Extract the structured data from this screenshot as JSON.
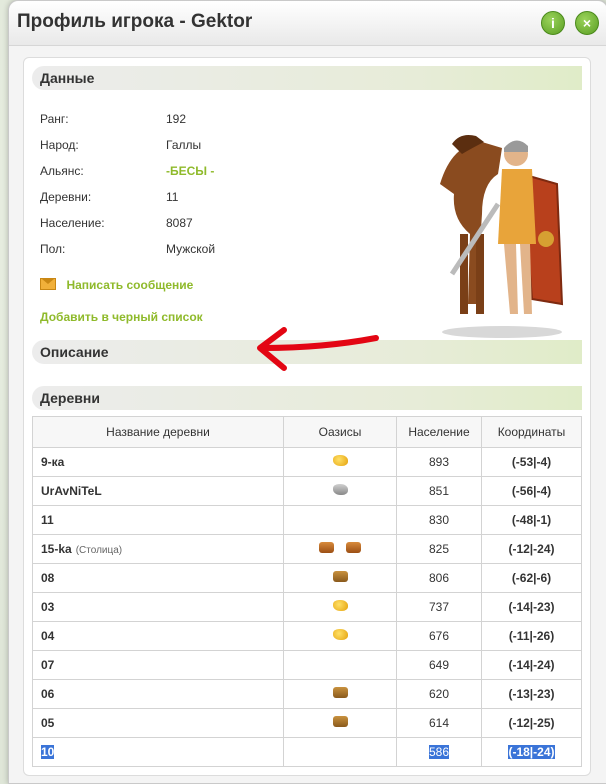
{
  "window": {
    "title": "Профиль игрока - Gektor",
    "info_icon": "info-icon",
    "close_icon": "close-icon"
  },
  "data_section": {
    "heading": "Данные",
    "fields": [
      {
        "label": "Ранг:",
        "value": "192"
      },
      {
        "label": "Народ:",
        "value": "Галлы"
      },
      {
        "label": "Альянс:",
        "value": "-БЕСЫ -"
      },
      {
        "label": "Деревни:",
        "value": "11"
      },
      {
        "label": "Население:",
        "value": "8087"
      },
      {
        "label": "Пол:",
        "value": "Мужской"
      }
    ],
    "send_message": "Написать сообщение",
    "blacklist": "Добавить в черный список"
  },
  "description_section": {
    "heading": "Описание"
  },
  "villages_section": {
    "heading": "Деревни",
    "columns": [
      "Название деревни",
      "Оазисы",
      "Население",
      "Координаты"
    ],
    "rows": [
      {
        "name": "9-ка",
        "capital": "",
        "oases": [
          "wheat-iron"
        ],
        "population": "893",
        "coords": "(-53|-4)"
      },
      {
        "name": "UrAvNiTeL",
        "capital": "",
        "oases": [
          "iron"
        ],
        "population": "851",
        "coords": "(-56|-4)"
      },
      {
        "name": "11",
        "capital": "",
        "oases": [],
        "population": "830",
        "coords": "(-48|-1)"
      },
      {
        "name": "15-ka",
        "capital": "(Столица)",
        "oases": [
          "clay-wheat",
          "clay-wheat"
        ],
        "population": "825",
        "coords": "(-12|-24)"
      },
      {
        "name": "08",
        "capital": "",
        "oases": [
          "wood-wheat"
        ],
        "population": "806",
        "coords": "(-62|-6)"
      },
      {
        "name": "03",
        "capital": "",
        "oases": [
          "wheat"
        ],
        "population": "737",
        "coords": "(-14|-23)"
      },
      {
        "name": "04",
        "capital": "",
        "oases": [
          "wheat"
        ],
        "population": "676",
        "coords": "(-11|-26)"
      },
      {
        "name": "07",
        "capital": "",
        "oases": [],
        "population": "649",
        "coords": "(-14|-24)"
      },
      {
        "name": "06",
        "capital": "",
        "oases": [
          "wood"
        ],
        "population": "620",
        "coords": "(-13|-23)"
      },
      {
        "name": "05",
        "capital": "",
        "oases": [
          "wood"
        ],
        "population": "614",
        "coords": "(-12|-25)"
      },
      {
        "name": "10",
        "capital": "",
        "oases": [],
        "population": "586",
        "coords": "(-18|-24)"
      }
    ]
  },
  "colors": {
    "accent_green": "#8fba2b",
    "selection_blue": "#3a74d8",
    "annotation_red": "#e30613"
  }
}
